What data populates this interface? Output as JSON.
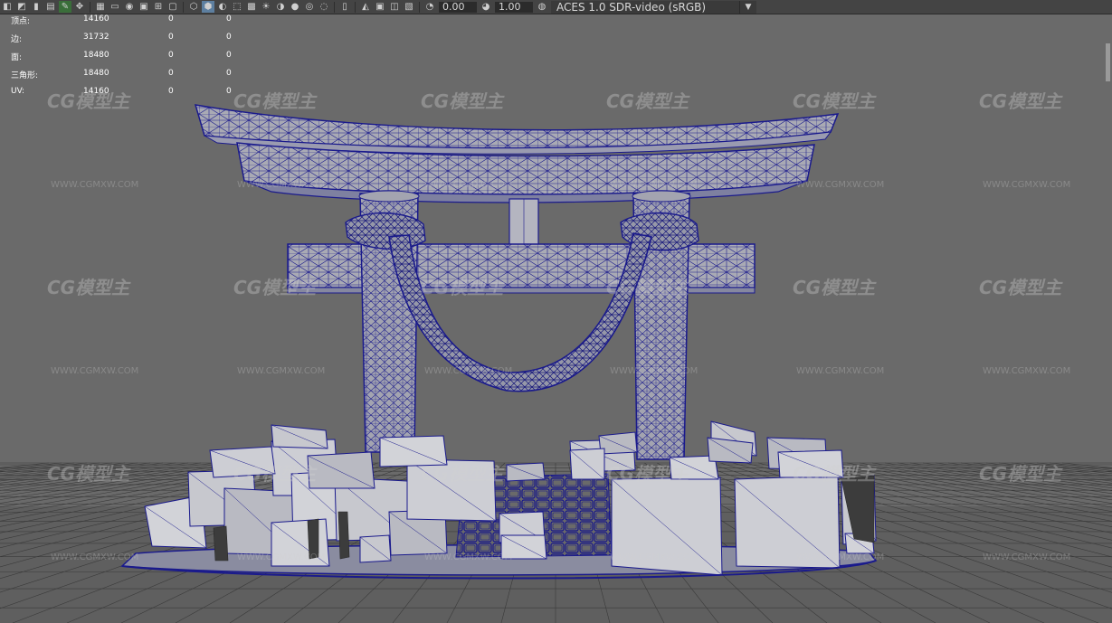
{
  "toolbar": {
    "icons": [
      "camera-icon",
      "camera-attr-icon",
      "bookmark-icon",
      "image-plane-icon",
      "grease-pencil-icon",
      "2d-pan-icon",
      "grid-icon",
      "film-gate-icon",
      "resolution-gate-icon",
      "gate-mask-icon",
      "field-chart-icon",
      "safe-action-icon",
      "wireframe-icon",
      "smooth-shade-icon",
      "flat-shade-icon",
      "bounding-box-icon",
      "xray-icon",
      "use-lights-icon",
      "shadows-icon",
      "ambient-occlusion-icon",
      "motion-blur-icon",
      "antialias-icon",
      "depth-of-field-icon",
      "isolate-icon",
      "xray-joints-icon",
      "xray-active-icon",
      "backface-icon",
      "exposure-icon",
      "gamma-icon",
      "colorspace-icon"
    ],
    "exposure_value": "0.00",
    "gamma_value": "1.00",
    "color_space": "ACES 1.0 SDR-video (sRGB)"
  },
  "hud": {
    "rows": [
      {
        "label": "顶点:",
        "v1": "14160",
        "v2": "0",
        "v3": "0"
      },
      {
        "label": "边:",
        "v1": "31732",
        "v2": "0",
        "v3": "0"
      },
      {
        "label": "面:",
        "v1": "18480",
        "v2": "0",
        "v3": "0"
      },
      {
        "label": "三角形:",
        "v1": "18480",
        "v2": "0",
        "v3": "0"
      },
      {
        "label": "UV:",
        "v1": "14160",
        "v2": "0",
        "v3": "0"
      }
    ]
  },
  "watermark": {
    "logo": "CG模型主",
    "url": "WWW.CGMXW.COM"
  },
  "colors": {
    "viewport_bg": "#6a6a6a",
    "wire": "#1a1a8c",
    "surface": "#a9aab4",
    "surface_light": "#c4c5cc",
    "grid": "#3c3c3c"
  }
}
